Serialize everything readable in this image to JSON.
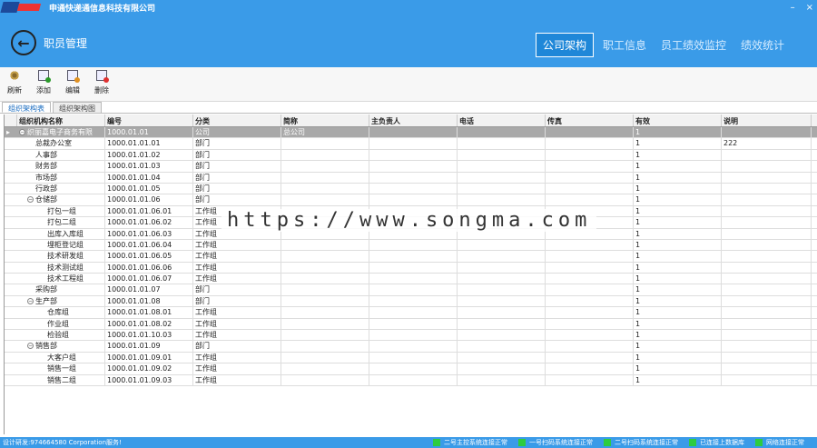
{
  "titlebar": {
    "app_title": "申通快递通信息科技有限公司",
    "min": "–",
    "close": "×"
  },
  "header": {
    "page_title": "职员管理",
    "back_glyph": "←"
  },
  "nav": {
    "tabs": [
      "公司架构",
      "职工信息",
      "员工绩效监控",
      "绩效统计"
    ],
    "active": 0
  },
  "toolbar": {
    "refresh": "刷新",
    "add": "添加",
    "edit": "编辑",
    "delete": "删除"
  },
  "subtabs": [
    "组织架构表",
    "组织架构图"
  ],
  "grid": {
    "headers": [
      "组织机构名称",
      "编号",
      "分类",
      "简称",
      "主负责人",
      "电话",
      "传真",
      "有效",
      "说明"
    ],
    "rows": [
      {
        "name": "织丽嘉电子商务有限",
        "code": "1000.01.01",
        "type": "公司",
        "short": "总公司",
        "valid": "1",
        "note": "",
        "level": 0,
        "exp": true
      },
      {
        "name": "总裁办公室",
        "code": "1000.01.01.01",
        "type": "部门",
        "short": "",
        "valid": "1",
        "note": "222",
        "level": 1
      },
      {
        "name": "人事部",
        "code": "1000.01.01.02",
        "type": "部门",
        "short": "",
        "valid": "1",
        "note": "",
        "level": 1
      },
      {
        "name": "财务部",
        "code": "1000.01.01.03",
        "type": "部门",
        "short": "",
        "valid": "1",
        "note": "",
        "level": 1
      },
      {
        "name": "市场部",
        "code": "1000.01.01.04",
        "type": "部门",
        "short": "",
        "valid": "1",
        "note": "",
        "level": 1
      },
      {
        "name": "行政部",
        "code": "1000.01.01.05",
        "type": "部门",
        "short": "",
        "valid": "1",
        "note": "",
        "level": 1
      },
      {
        "name": "仓储部",
        "code": "1000.01.01.06",
        "type": "部门",
        "short": "",
        "valid": "1",
        "note": "",
        "level": 1,
        "exp": true
      },
      {
        "name": "打包一组",
        "code": "1000.01.01.06.01",
        "type": "工作组",
        "short": "",
        "valid": "1",
        "note": "",
        "level": 2
      },
      {
        "name": "打包二组",
        "code": "1000.01.01.06.02",
        "type": "工作组",
        "short": "",
        "valid": "1",
        "note": "",
        "level": 2
      },
      {
        "name": "出库入库组",
        "code": "1000.01.01.06.03",
        "type": "工作组",
        "short": "",
        "valid": "1",
        "note": "",
        "level": 2
      },
      {
        "name": "埋柜登记组",
        "code": "1000.01.01.06.04",
        "type": "工作组",
        "short": "",
        "valid": "1",
        "note": "",
        "level": 2
      },
      {
        "name": "技术研发组",
        "code": "1000.01.01.06.05",
        "type": "工作组",
        "short": "",
        "valid": "1",
        "note": "",
        "level": 2
      },
      {
        "name": "技术测试组",
        "code": "1000.01.01.06.06",
        "type": "工作组",
        "short": "",
        "valid": "1",
        "note": "",
        "level": 2
      },
      {
        "name": "技术工程组",
        "code": "1000.01.01.06.07",
        "type": "工作组",
        "short": "",
        "valid": "1",
        "note": "",
        "level": 2
      },
      {
        "name": "采购部",
        "code": "1000.01.01.07",
        "type": "部门",
        "short": "",
        "valid": "1",
        "note": "",
        "level": 1
      },
      {
        "name": "生产部",
        "code": "1000.01.01.08",
        "type": "部门",
        "short": "",
        "valid": "1",
        "note": "",
        "level": 1,
        "exp": true
      },
      {
        "name": "仓库组",
        "code": "1000.01.01.08.01",
        "type": "工作组",
        "short": "",
        "valid": "1",
        "note": "",
        "level": 2
      },
      {
        "name": "作业组",
        "code": "1000.01.01.08.02",
        "type": "工作组",
        "short": "",
        "valid": "1",
        "note": "",
        "level": 2
      },
      {
        "name": "检验组",
        "code": "1000.01.01.10.03",
        "type": "工作组",
        "short": "",
        "valid": "1",
        "note": "",
        "level": 2
      },
      {
        "name": "销售部",
        "code": "1000.01.01.09",
        "type": "部门",
        "short": "",
        "valid": "1",
        "note": "",
        "level": 1,
        "exp": true
      },
      {
        "name": "大客户组",
        "code": "1000.01.01.09.01",
        "type": "工作组",
        "short": "",
        "valid": "1",
        "note": "",
        "level": 2
      },
      {
        "name": "销售一组",
        "code": "1000.01.01.09.02",
        "type": "工作组",
        "short": "",
        "valid": "1",
        "note": "",
        "level": 2
      },
      {
        "name": "销售二组",
        "code": "1000.01.01.09.03",
        "type": "工作组",
        "short": "",
        "valid": "1",
        "note": "",
        "level": 2
      }
    ]
  },
  "watermark": "https://www.songma.com",
  "status": {
    "left": "设计研发:974664580 Corporation服务!",
    "indicators": [
      "二号主控系统连接正常",
      "一号扫码系统连接正常",
      "二号扫码系统连接正常",
      "已连接上数据库",
      "网络连接正常"
    ],
    "ok_color": "#2ecc40"
  }
}
